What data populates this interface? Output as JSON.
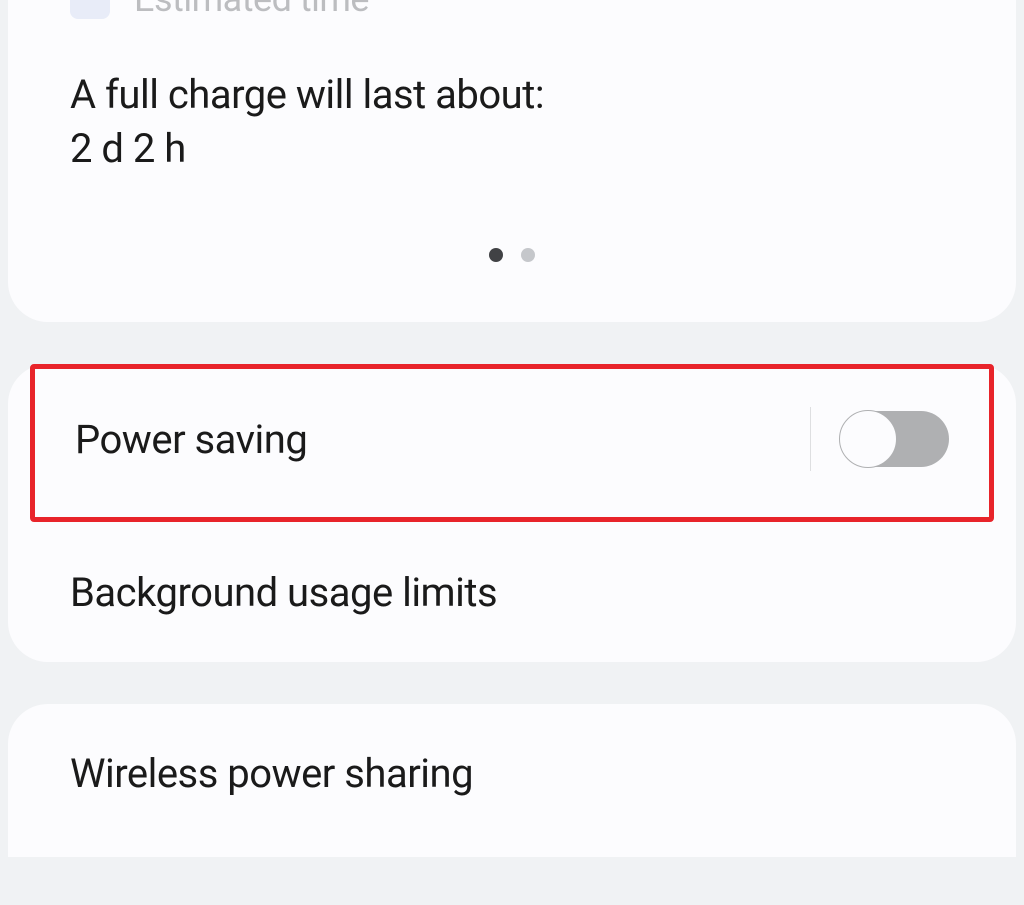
{
  "battery": {
    "estimated_time_label": "Estimated time",
    "charge_description": "A full charge will last about:",
    "charge_duration": "2 d 2 h"
  },
  "settings": {
    "power_saving": {
      "label": "Power saving",
      "enabled": false
    },
    "background_limits": {
      "label": "Background usage limits"
    },
    "wireless_sharing": {
      "label": "Wireless power sharing"
    }
  },
  "pagination": {
    "current": 1,
    "total": 2
  }
}
